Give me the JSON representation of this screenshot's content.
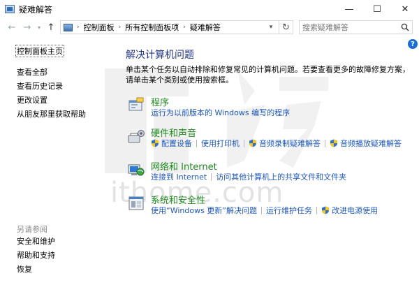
{
  "window": {
    "title": "疑难解答",
    "min_glyph": "—",
    "max_glyph": "☐",
    "close_glyph": "✕"
  },
  "nav": {
    "back_glyph": "←",
    "forward_glyph": "→",
    "up_glyph": "↑",
    "breadcrumbs": [
      "控制面板",
      "所有控制面板项",
      "疑难解答"
    ],
    "search_placeholder": "搜索疑难解答"
  },
  "help_label": "?",
  "sidebar": {
    "home": "控制面板主页",
    "items": [
      "查看全部",
      "查看历史记录",
      "更改设置",
      "从朋友那里获取帮助"
    ],
    "see_also_title": "另请参阅",
    "see_also": [
      "安全和维护",
      "帮助和支持",
      "恢复"
    ]
  },
  "main": {
    "title": "解决计算机问题",
    "description": "单击某个任务以自动排除和修复常见的计算机问题。若要查看更多的故障修复方案，请单击某个类别或使用搜索框。",
    "categories": [
      {
        "title": "程序",
        "links": [
          {
            "label": "运行为以前版本的 Windows 编写的程序",
            "shield": false
          }
        ]
      },
      {
        "title": "硬件和声音",
        "links": [
          {
            "label": "配置设备",
            "shield": true
          },
          {
            "label": "使用打印机",
            "shield": false
          },
          {
            "label": "音频录制疑难解答",
            "shield": true
          },
          {
            "label": "音频播放疑难解答",
            "shield": true
          }
        ]
      },
      {
        "title": "网络和 Internet",
        "links": [
          {
            "label": "连接到 Internet",
            "shield": false
          },
          {
            "label": "访问其他计算机上的共享文件和文件夹",
            "shield": false
          }
        ]
      },
      {
        "title": "系统和安全性",
        "links": [
          {
            "label": "使用“Windows 更新”解决问题",
            "shield": false
          },
          {
            "label": "运行维护任务",
            "shield": false
          },
          {
            "label": "改进电源使用",
            "shield": true
          }
        ]
      }
    ]
  },
  "watermark": {
    "text": "ithome.com"
  },
  "colors": {
    "title_blue": "#1e3287",
    "category_green": "#1e8a1e",
    "link_blue": "#1c57c2",
    "help_blue": "#1a6fd6"
  }
}
